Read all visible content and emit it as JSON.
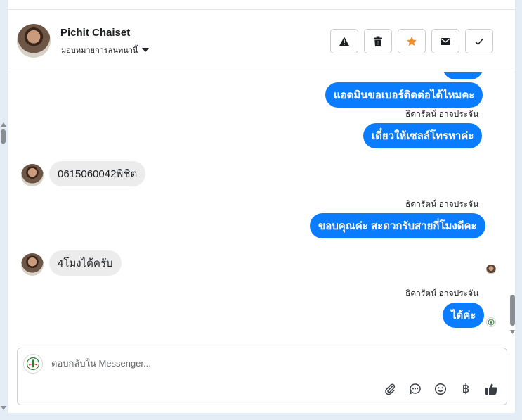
{
  "header": {
    "contact_name": "Pichit Chaiset",
    "assign_label": "มอบหมายการสนทนานี้",
    "actions": [
      {
        "icon": "warning-icon",
        "label": "Mark as spam"
      },
      {
        "icon": "trash-icon",
        "label": "Delete"
      },
      {
        "icon": "star-icon",
        "label": "Follow up",
        "color": "#f28c28"
      },
      {
        "icon": "envelope-icon",
        "label": "Mark as unread"
      },
      {
        "icon": "checkmark-icon",
        "label": "Mark as done"
      }
    ]
  },
  "messages": [
    {
      "direction": "out",
      "text": ""
    },
    {
      "direction": "out",
      "text": "แอดมินขอเบอร์ติดต่อได้ไหมคะ"
    },
    {
      "direction": "out",
      "sender": "ธิดารัตน์ อาจประจัน",
      "text": "เดี๋ยวให้เซลล์โทรหาค่ะ"
    },
    {
      "direction": "in",
      "text": "0615060042พิชิต"
    },
    {
      "direction": "out",
      "sender": "ธิดารัตน์ อาจประจัน",
      "text": "ขอบคุณค่ะ สะดวกรับสายกี่โมงดีคะ"
    },
    {
      "direction": "in",
      "text": "4โมงได้ครับ"
    },
    {
      "direction": "out",
      "sender": "ธิดารัตน์ อาจประจัน",
      "text": "ได้ค่ะ"
    }
  ],
  "composer": {
    "placeholder": "ตอบกลับใน Messenger...",
    "tools": [
      "paperclip-icon",
      "chat-bubble-icon",
      "smiley-icon",
      "baht-icon",
      "thumbs-up-icon"
    ],
    "baht_symbol": "฿"
  },
  "colors": {
    "outgoing_bubble": "#0a7cff",
    "incoming_bubble": "#ececec",
    "star": "#f28c28"
  }
}
